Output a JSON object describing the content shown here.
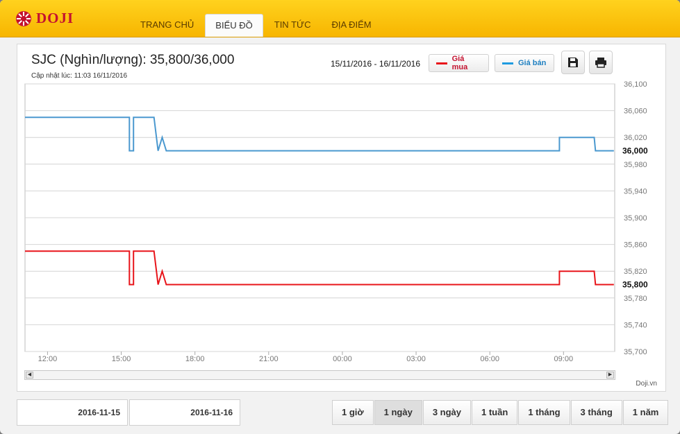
{
  "brand": {
    "name": "DOJI",
    "logo_color": "#c4122f"
  },
  "nav": {
    "items": [
      {
        "label": "TRANG CHỦ",
        "active": false
      },
      {
        "label": "BIỂU ĐỒ",
        "active": true
      },
      {
        "label": "TIN TỨC",
        "active": false
      },
      {
        "label": "ĐỊA ĐIỂM",
        "active": false
      }
    ]
  },
  "header": {
    "title": "SJC (Nghìn/lượng): 35,800/36,000",
    "updated": "Cập nhật lúc: 11:03 16/11/2016",
    "range": "15/11/2016 - 16/11/2016",
    "legend_buy": "Giá mua",
    "legend_sell": "Giá bán",
    "save_icon": "save-icon",
    "print_icon": "print-icon"
  },
  "colors": {
    "buy": "#e8141a",
    "sell": "#4a98cf",
    "accent": "#f7b500"
  },
  "chart_data": {
    "type": "line",
    "xlabel": "",
    "ylabel": "",
    "grid": true,
    "x_ticks": [
      "12:00",
      "15:00",
      "18:00",
      "21:00",
      "00:00",
      "03:00",
      "06:00",
      "09:00"
    ],
    "y_ticks": [
      36100,
      36060,
      36020,
      35980,
      35940,
      35900,
      35860,
      35820,
      35780,
      35740,
      35700
    ],
    "y_tick_labels": [
      "36,100",
      "36,060",
      "36,020",
      "35,980",
      "35,940",
      "35,900",
      "35,860",
      "35,820",
      "35,780",
      "35,740",
      "35,700"
    ],
    "ylim": [
      35700,
      36100
    ],
    "xlim": [
      "2016-11-15 11:05",
      "2016-11-16 11:05"
    ],
    "series": [
      {
        "name": "Giá bán",
        "color": "#4a98cf",
        "last_label": "36,000",
        "points": [
          [
            "2016-11-15 11:05",
            36050
          ],
          [
            "2016-11-15 15:20",
            36050
          ],
          [
            "2016-11-15 15:20",
            36000
          ],
          [
            "2016-11-15 15:30",
            36000
          ],
          [
            "2016-11-15 15:30",
            36050
          ],
          [
            "2016-11-15 16:20",
            36050
          ],
          [
            "2016-11-15 16:30",
            36000
          ],
          [
            "2016-11-15 16:40",
            36020
          ],
          [
            "2016-11-15 16:50",
            36000
          ],
          [
            "2016-11-16 08:50",
            36000
          ],
          [
            "2016-11-16 08:50",
            36020
          ],
          [
            "2016-11-16 10:15",
            36020
          ],
          [
            "2016-11-16 10:18",
            36000
          ],
          [
            "2016-11-16 11:03",
            36000
          ]
        ]
      },
      {
        "name": "Giá mua",
        "color": "#e8141a",
        "last_label": "35,800",
        "points": [
          [
            "2016-11-15 11:05",
            35850
          ],
          [
            "2016-11-15 15:20",
            35850
          ],
          [
            "2016-11-15 15:20",
            35800
          ],
          [
            "2016-11-15 15:30",
            35800
          ],
          [
            "2016-11-15 15:30",
            35850
          ],
          [
            "2016-11-15 16:20",
            35850
          ],
          [
            "2016-11-15 16:30",
            35800
          ],
          [
            "2016-11-15 16:40",
            35820
          ],
          [
            "2016-11-15 16:50",
            35800
          ],
          [
            "2016-11-16 08:50",
            35800
          ],
          [
            "2016-11-16 08:50",
            35820
          ],
          [
            "2016-11-16 10:15",
            35820
          ],
          [
            "2016-11-16 10:18",
            35800
          ],
          [
            "2016-11-16 11:03",
            35800
          ]
        ]
      }
    ]
  },
  "footer": {
    "credit": "Doji.vn",
    "date_from": "2016-11-15",
    "date_to": "2016-11-16",
    "periods": [
      {
        "label": "1 giờ",
        "active": false
      },
      {
        "label": "1 ngày",
        "active": true
      },
      {
        "label": "3 ngày",
        "active": false
      },
      {
        "label": "1 tuần",
        "active": false
      },
      {
        "label": "1 tháng",
        "active": false
      },
      {
        "label": "3 tháng",
        "active": false
      },
      {
        "label": "1 năm",
        "active": false
      }
    ]
  }
}
